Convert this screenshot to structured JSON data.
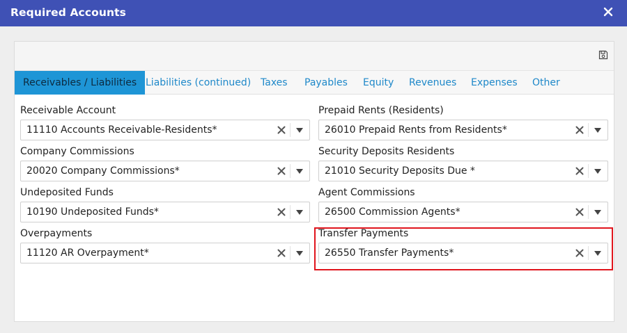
{
  "dialog": {
    "title": "Required Accounts"
  },
  "tabs": [
    {
      "label": "Receivables / Liabilities"
    },
    {
      "label": "Liabilities (continued)"
    },
    {
      "label": "Taxes"
    },
    {
      "label": "Payables"
    },
    {
      "label": "Equity"
    },
    {
      "label": "Revenues"
    },
    {
      "label": "Expenses"
    },
    {
      "label": "Other"
    }
  ],
  "fields": [
    {
      "label": "Receivable Account",
      "value": "11110 Accounts Receivable-Residents*"
    },
    {
      "label": "Prepaid Rents (Residents)",
      "value": "26010 Prepaid Rents from Residents*"
    },
    {
      "label": "Company Commissions",
      "value": "20020 Company Commissions*"
    },
    {
      "label": "Security Deposits Residents",
      "value": "21010 Security Deposits Due *"
    },
    {
      "label": "Undeposited Funds",
      "value": "10190 Undeposited Funds*"
    },
    {
      "label": "Agent Commissions",
      "value": "26500 Commission Agents*"
    },
    {
      "label": "Overpayments",
      "value": "11120 AR Overpayment*"
    },
    {
      "label": "Transfer Payments",
      "value": "26550 Transfer Payments*"
    }
  ],
  "colors": {
    "header": "#3f51b5",
    "active_tab": "#1e95d6",
    "tab_text": "#1e88c9",
    "highlight": "#e0141c"
  },
  "icons": {
    "close": "close-icon",
    "save": "save-icon",
    "clear": "clear-icon",
    "dropdown": "chevron-down-icon"
  }
}
